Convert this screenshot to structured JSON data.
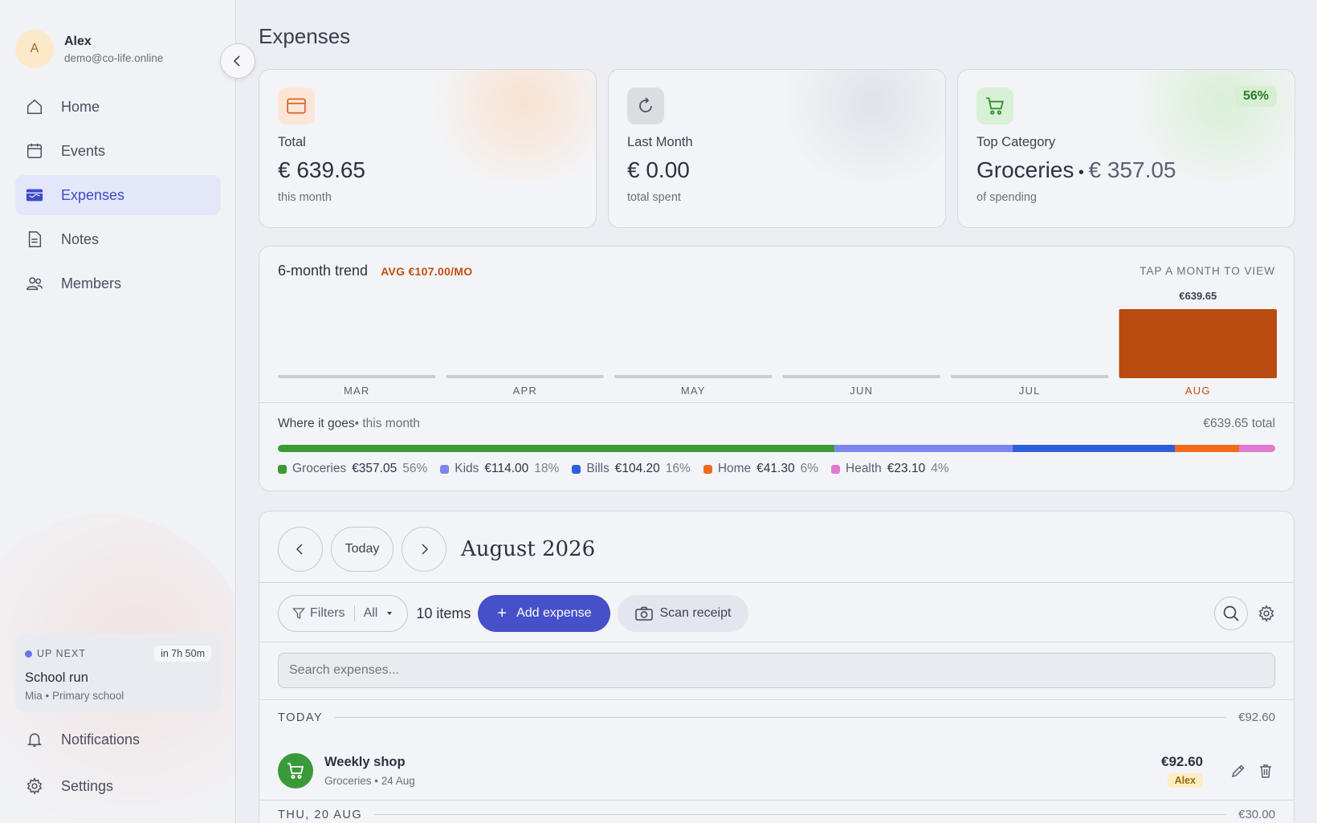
{
  "user": {
    "initial": "A",
    "name": "Alex",
    "email": "demo@co-life.online"
  },
  "nav": [
    {
      "label": "Home",
      "icon": "home-icon"
    },
    {
      "label": "Events",
      "icon": "calendar-icon"
    },
    {
      "label": "Expenses",
      "icon": "wallet-icon",
      "active": true
    },
    {
      "label": "Notes",
      "icon": "note-icon"
    },
    {
      "label": "Members",
      "icon": "members-icon"
    }
  ],
  "upnext": {
    "label": "UP NEXT",
    "badge": "in 7h 50m",
    "title": "School run",
    "subtitle": "Mia • Primary school"
  },
  "bottom_nav": [
    {
      "label": "Notifications",
      "icon": "bell-icon"
    },
    {
      "label": "Settings",
      "icon": "gear-icon"
    }
  ],
  "page_title": "Expenses",
  "stats": [
    {
      "label": "Total",
      "value": "€ 639.65",
      "sub": "this month",
      "icon": "wallet-icon",
      "accent": "#fde6d6"
    },
    {
      "label": "Last Month",
      "value": "€ 0.00",
      "sub": "total spent",
      "icon": "refresh-icon",
      "accent": "#dcdde3"
    },
    {
      "label": "Top Category",
      "value_main": "Groceries",
      "value_dot": " • ",
      "value_amount": "€ 357.05",
      "sub": "of spending",
      "badge": "56%",
      "icon": "cart-icon",
      "accent": "#d9f0d6"
    }
  ],
  "trend": {
    "title": "6-month trend",
    "avg": "AVG €107.00/MO",
    "hint": "TAP A MONTH TO VIEW",
    "where_title": "Where it goes",
    "where_sub": " • this month",
    "where_total": "€639.65 total"
  },
  "chart_data": {
    "type": "bar",
    "categories": [
      "MAR",
      "APR",
      "MAY",
      "JUN",
      "JUL",
      "AUG"
    ],
    "values": [
      0,
      0,
      0,
      0,
      0,
      639.65
    ],
    "value_labels": [
      "",
      "",
      "",
      "",
      "",
      "€639.65"
    ],
    "highlight": "AUG",
    "colors": {
      "bar": "#b94a10",
      "empty": "#c9ccd6",
      "label_active": "#c24f12"
    }
  },
  "breakdown": [
    {
      "name": "Groceries",
      "amount": "€357.05",
      "pct": "56%",
      "share": 357.05,
      "color": "#3c9a34"
    },
    {
      "name": "Kids",
      "amount": "€114.00",
      "pct": "18%",
      "share": 114.0,
      "color": "#7d86ee"
    },
    {
      "name": "Bills",
      "amount": "€104.20",
      "pct": "16%",
      "share": 104.2,
      "color": "#2d5fdc"
    },
    {
      "name": "Home",
      "amount": "€41.30",
      "pct": "6%",
      "share": 41.3,
      "color": "#f06a1c"
    },
    {
      "name": "Health",
      "amount": "€23.10",
      "pct": "4%",
      "share": 23.1,
      "color": "#e07ad0"
    }
  ],
  "list": {
    "today_label": "Today",
    "month": "August 2026",
    "filters_label": "Filters",
    "filter_value": "All",
    "items_count": "10 items",
    "add_label": "Add expense",
    "scan_label": "Scan receipt",
    "search_placeholder": "Search expenses...",
    "groups": [
      {
        "label": "TODAY",
        "total": "€92.60"
      },
      {
        "label": "THU, 20 AUG",
        "total": "€30.00"
      }
    ],
    "expense": {
      "title": "Weekly shop",
      "sub": "Groceries • 24 Aug",
      "amount": "€92.60",
      "who": "Alex"
    }
  }
}
